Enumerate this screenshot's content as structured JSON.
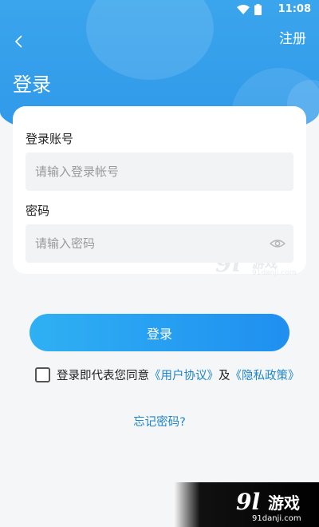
{
  "status_bar": {
    "time": "11:08"
  },
  "header": {
    "register_label": "注册",
    "title": "登录"
  },
  "form": {
    "account_label": "登录账号",
    "account_placeholder": "请输入登录帐号",
    "account_value": "",
    "password_label": "密码",
    "password_placeholder": "请输入密码",
    "password_value": ""
  },
  "login_button_label": "登录",
  "agreement": {
    "checked": false,
    "prefix": "登录即代表您同意",
    "user_agreement": "《用户协议》",
    "and": "及",
    "privacy_policy": "《隐私政策》"
  },
  "forgot_password": "忘记密码?",
  "watermark": {
    "number": "9l",
    "name": "游戏",
    "domain": "91danji.com"
  },
  "colors": {
    "primary": "#2f98ea",
    "link": "#1e86c8",
    "input_bg": "#f2f3f5",
    "page_bg": "#f4f6f8"
  }
}
